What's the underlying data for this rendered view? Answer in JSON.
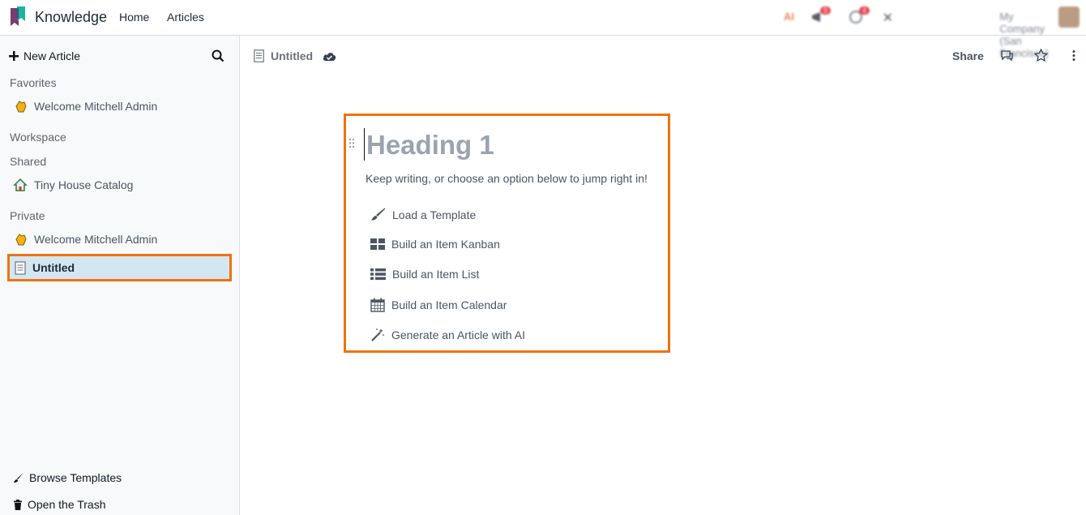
{
  "navbar": {
    "app_name": "Knowledge",
    "menu": [
      "Home",
      "Articles"
    ],
    "company": "My Company (San Francisco)",
    "ai_label": "AI",
    "messages_badge": "9",
    "activities_badge": "4"
  },
  "sidebar": {
    "new_article_label": "New Article",
    "sections": {
      "favorites": "Favorites",
      "workspace": "Workspace",
      "shared": "Shared",
      "private": "Private"
    },
    "favorites_items": [
      "Welcome Mitchell Admin"
    ],
    "shared_items": [
      "Tiny House Catalog"
    ],
    "private_items": [
      "Welcome Mitchell Admin",
      "Untitled"
    ],
    "browse_templates": "Browse Templates",
    "open_trash": "Open the Trash"
  },
  "article": {
    "title": "Untitled",
    "share_label": "Share",
    "heading_placeholder": "Heading 1",
    "hint": "Keep writing, or choose an option below to jump right in!",
    "options": [
      {
        "label": "Load a Template",
        "icon": "paintbrush-icon"
      },
      {
        "label": "Build an Item Kanban",
        "icon": "kanban-icon"
      },
      {
        "label": "Build an Item List",
        "icon": "list-icon"
      },
      {
        "label": "Build an Item Calendar",
        "icon": "calendar-icon"
      },
      {
        "label": "Generate an Article with AI",
        "icon": "magic-wand-icon"
      }
    ]
  },
  "colors": {
    "highlight": "#f0720f",
    "active_item": "#d3e7f2",
    "badge": "#e4212b"
  }
}
